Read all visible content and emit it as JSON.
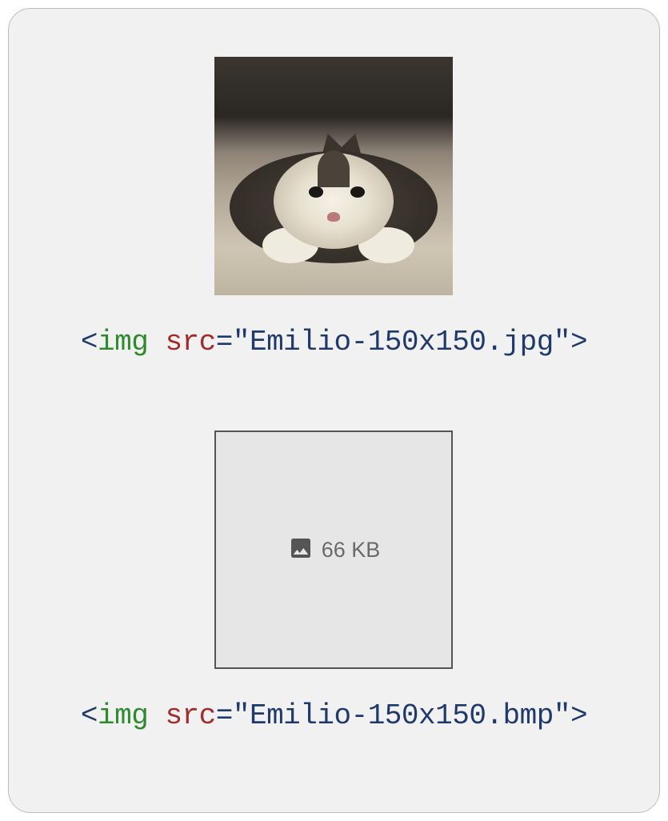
{
  "examples": [
    {
      "kind": "photo",
      "code": {
        "tag": "img",
        "attr": "src",
        "value": "\"Emilio-150x150.jpg\""
      }
    },
    {
      "kind": "placeholder",
      "size_label": "66 KB",
      "code": {
        "tag": "img",
        "attr": "src",
        "value": "\"Emilio-150x150.bmp\""
      }
    }
  ]
}
